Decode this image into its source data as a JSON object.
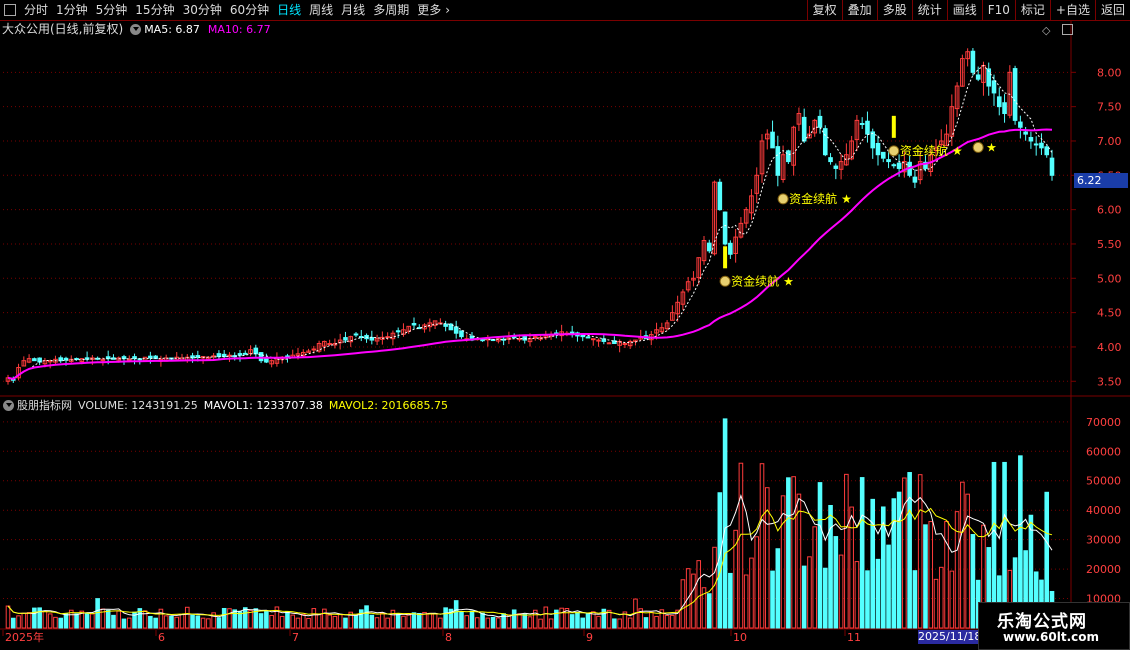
{
  "toolbar": {
    "periods": [
      "分时",
      "1分钟",
      "5分钟",
      "15分钟",
      "30分钟",
      "60分钟",
      "日线",
      "周线",
      "月线",
      "多周期",
      "更多"
    ],
    "active_period": "日线",
    "actions": [
      "复权",
      "叠加",
      "多股",
      "统计",
      "画线",
      "F10",
      "标记",
      "+自选",
      "返回"
    ]
  },
  "stock": {
    "title": "大众公用(日线,前复权)",
    "ma5_label": "MA5: 6.87",
    "ma10_label": "MA10: 6.77"
  },
  "indicator": {
    "name": "股朋指标网",
    "volume_label": "VOLUME: 1243191.25",
    "mavol1_label": "MAVOL1: 1233707.38",
    "mavol2_label": "MAVOL2: 2016685.75"
  },
  "signal_label": "资金续航",
  "last_price_label": "6.22",
  "selected_date": "2025/11/18",
  "watermark": {
    "title": "乐淘公式网",
    "url": "www.60lt.com"
  },
  "colors": {
    "up": "#ff3c3c",
    "down": "#54ffff",
    "ma_white": "#ffffff",
    "ma_magenta": "#ff00ff",
    "signal": "#ffff00",
    "grid": "#7a0000",
    "axis_text": "#ff4040"
  },
  "chart_data": [
    {
      "type": "candlestick",
      "y_ticks": [
        8.0,
        7.5,
        7.0,
        6.5,
        6.0,
        5.5,
        5.0,
        4.5,
        4.0,
        3.5
      ],
      "ylim": [
        3.3,
        8.5
      ],
      "x_labels": [
        "2025年",
        "6",
        "7",
        "8",
        "9",
        "10",
        "11"
      ],
      "close_approx": [
        3.55,
        3.52,
        3.7,
        3.8,
        3.83,
        3.8,
        3.78,
        3.8,
        3.8,
        3.82,
        3.8,
        3.81,
        3.82,
        3.82,
        3.83,
        3.82,
        3.84,
        3.83,
        3.82,
        3.83,
        3.82,
        3.84,
        3.83,
        3.82,
        3.83,
        3.82,
        3.85,
        3.84,
        3.83,
        3.82,
        3.84,
        3.83,
        3.85,
        3.84,
        3.85,
        3.84,
        3.85,
        3.86,
        3.85,
        3.87,
        3.86,
        3.86,
        3.88,
        3.87,
        3.88,
        3.9,
        3.96,
        3.9,
        3.8,
        3.78,
        3.8,
        3.83,
        3.85,
        3.86,
        3.88,
        3.9,
        3.92,
        3.94,
        3.97,
        4.05,
        4.08,
        4.05,
        4.05,
        4.1,
        4.1,
        4.15,
        4.18,
        4.15,
        4.12,
        4.1,
        4.12,
        4.14,
        4.15,
        4.2,
        4.22,
        4.25,
        4.3,
        4.32,
        4.28,
        4.32,
        4.35,
        4.38,
        4.35,
        4.3,
        4.25,
        4.2,
        4.15,
        4.12,
        4.1,
        4.12,
        4.1,
        4.12,
        4.1,
        4.12,
        4.11,
        4.13,
        4.14,
        4.12,
        4.1,
        4.12,
        4.15,
        4.14,
        4.16,
        4.18,
        4.2,
        4.22,
        4.2,
        4.18,
        4.16,
        4.15,
        4.14,
        4.12,
        4.1,
        4.08,
        4.06,
        4.05,
        4.08,
        4.05,
        4.08,
        4.1,
        4.15,
        4.12,
        4.18,
        4.25,
        4.28,
        4.35,
        4.5,
        4.65,
        4.8,
        4.95,
        5.0,
        5.3,
        5.55,
        5.4,
        6.4,
        6.0,
        5.5,
        5.35,
        5.6,
        5.8,
        6.0,
        6.2,
        6.5,
        7.0,
        7.1,
        6.9,
        6.5,
        6.8,
        6.7,
        7.2,
        7.4,
        7.0,
        7.1,
        7.3,
        7.2,
        6.8,
        6.7,
        6.6,
        6.7,
        6.8,
        7.0,
        7.3,
        7.25,
        7.1,
        6.9,
        6.8,
        6.75,
        6.7,
        6.65,
        6.6,
        6.7,
        6.5,
        6.4,
        6.7,
        6.6,
        6.8,
        6.9,
        7.0,
        7.1,
        7.5,
        7.8,
        8.2,
        8.3,
        8.0,
        7.9,
        8.1,
        7.8,
        7.7,
        7.5,
        7.4,
        8.0,
        7.3,
        7.2,
        7.1,
        7.0,
        6.95,
        6.9,
        6.8,
        6.5
      ],
      "ma10_approx_start": 3.8,
      "ma10_approx_end": 6.77,
      "signals": [
        {
          "x_approx": "9月末",
          "y": 5.0
        },
        {
          "x_approx": "10月初",
          "y": 6.2
        },
        {
          "x_approx": "10月下旬",
          "y": 6.9
        },
        {
          "x_approx": "11月初",
          "y": 6.95
        }
      ]
    },
    {
      "type": "bar",
      "y_ticks": [
        70000,
        60000,
        50000,
        40000,
        30000,
        20000,
        10000
      ],
      "ylim": [
        0,
        73000
      ],
      "series": [
        {
          "name": "VOLUME"
        },
        {
          "name": "MAVOL1"
        },
        {
          "name": "MAVOL2"
        }
      ]
    }
  ]
}
